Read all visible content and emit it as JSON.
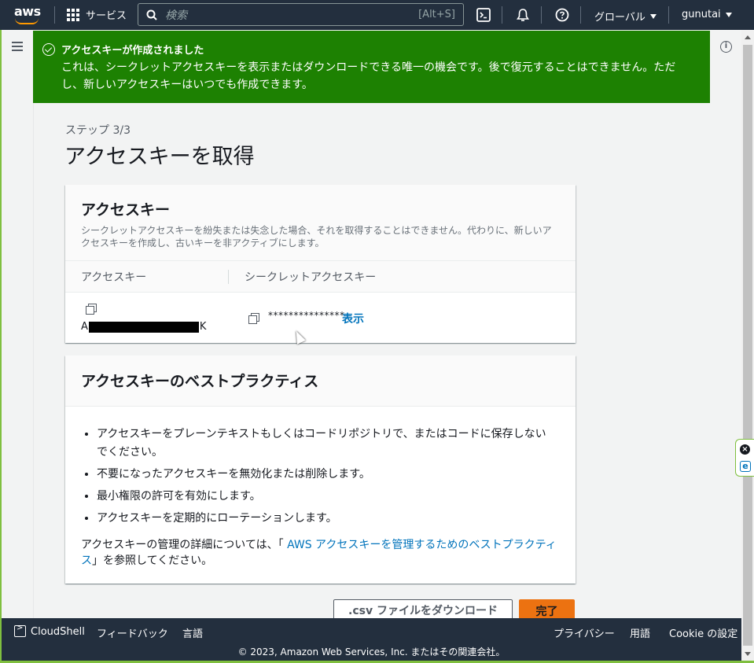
{
  "topnav": {
    "logo": "aws",
    "services_label": "サービス",
    "search_placeholder": "検索",
    "search_shortcut": "[Alt+S]",
    "region_label": "グローバル",
    "user_label": "gunutai"
  },
  "flash": {
    "title": "アクセスキーが作成されました",
    "message": "これは、シークレットアクセスキーを表示またはダウンロードできる唯一の機会です。後で復元することはできません。ただし、新しいアクセスキーはいつでも作成できます。",
    "color": "#1d8102"
  },
  "page": {
    "step": "ステップ 3/3",
    "title": "アクセスキーを取得"
  },
  "access_key_card": {
    "heading": "アクセスキー",
    "description": "シークレットアクセスキーを紛失または失念した場合、それを取得することはできません。代わりに、新しいアクセスキーを作成し、古いキーを非アクティブにします。",
    "col_access_key": "アクセスキー",
    "col_secret": "シークレットアクセスキー",
    "access_key_prefix": "A",
    "access_key_suffix": "K",
    "secret_masked": "***************",
    "show_label": "表示"
  },
  "best_practices": {
    "heading": "アクセスキーのベストプラクティス",
    "items": [
      "アクセスキーをプレーンテキストもしくはコードリポジトリで、またはコードに保存しないでください。",
      "不要になったアクセスキーを無効化または削除します。",
      "最小権限の許可を有効にします。",
      "アクセスキーを定期的にローテーションします。"
    ],
    "note_prefix": "アクセスキーの管理の詳細については、「 ",
    "note_link": "AWS アクセスキーを管理するためのベストプラクティス",
    "note_suffix": "」を参照してください。"
  },
  "actions": {
    "download_csv": ".csv ファイルをダウンロード",
    "done": "完了",
    "primary_color": "#ec7211"
  },
  "footer": {
    "cloudshell": "CloudShell",
    "feedback": "フィードバック",
    "language": "言語",
    "privacy": "プライバシー",
    "terms": "用語",
    "cookie": "Cookie の設定",
    "copyright": "© 2023, Amazon Web Services, Inc. またはその関連会社。"
  }
}
